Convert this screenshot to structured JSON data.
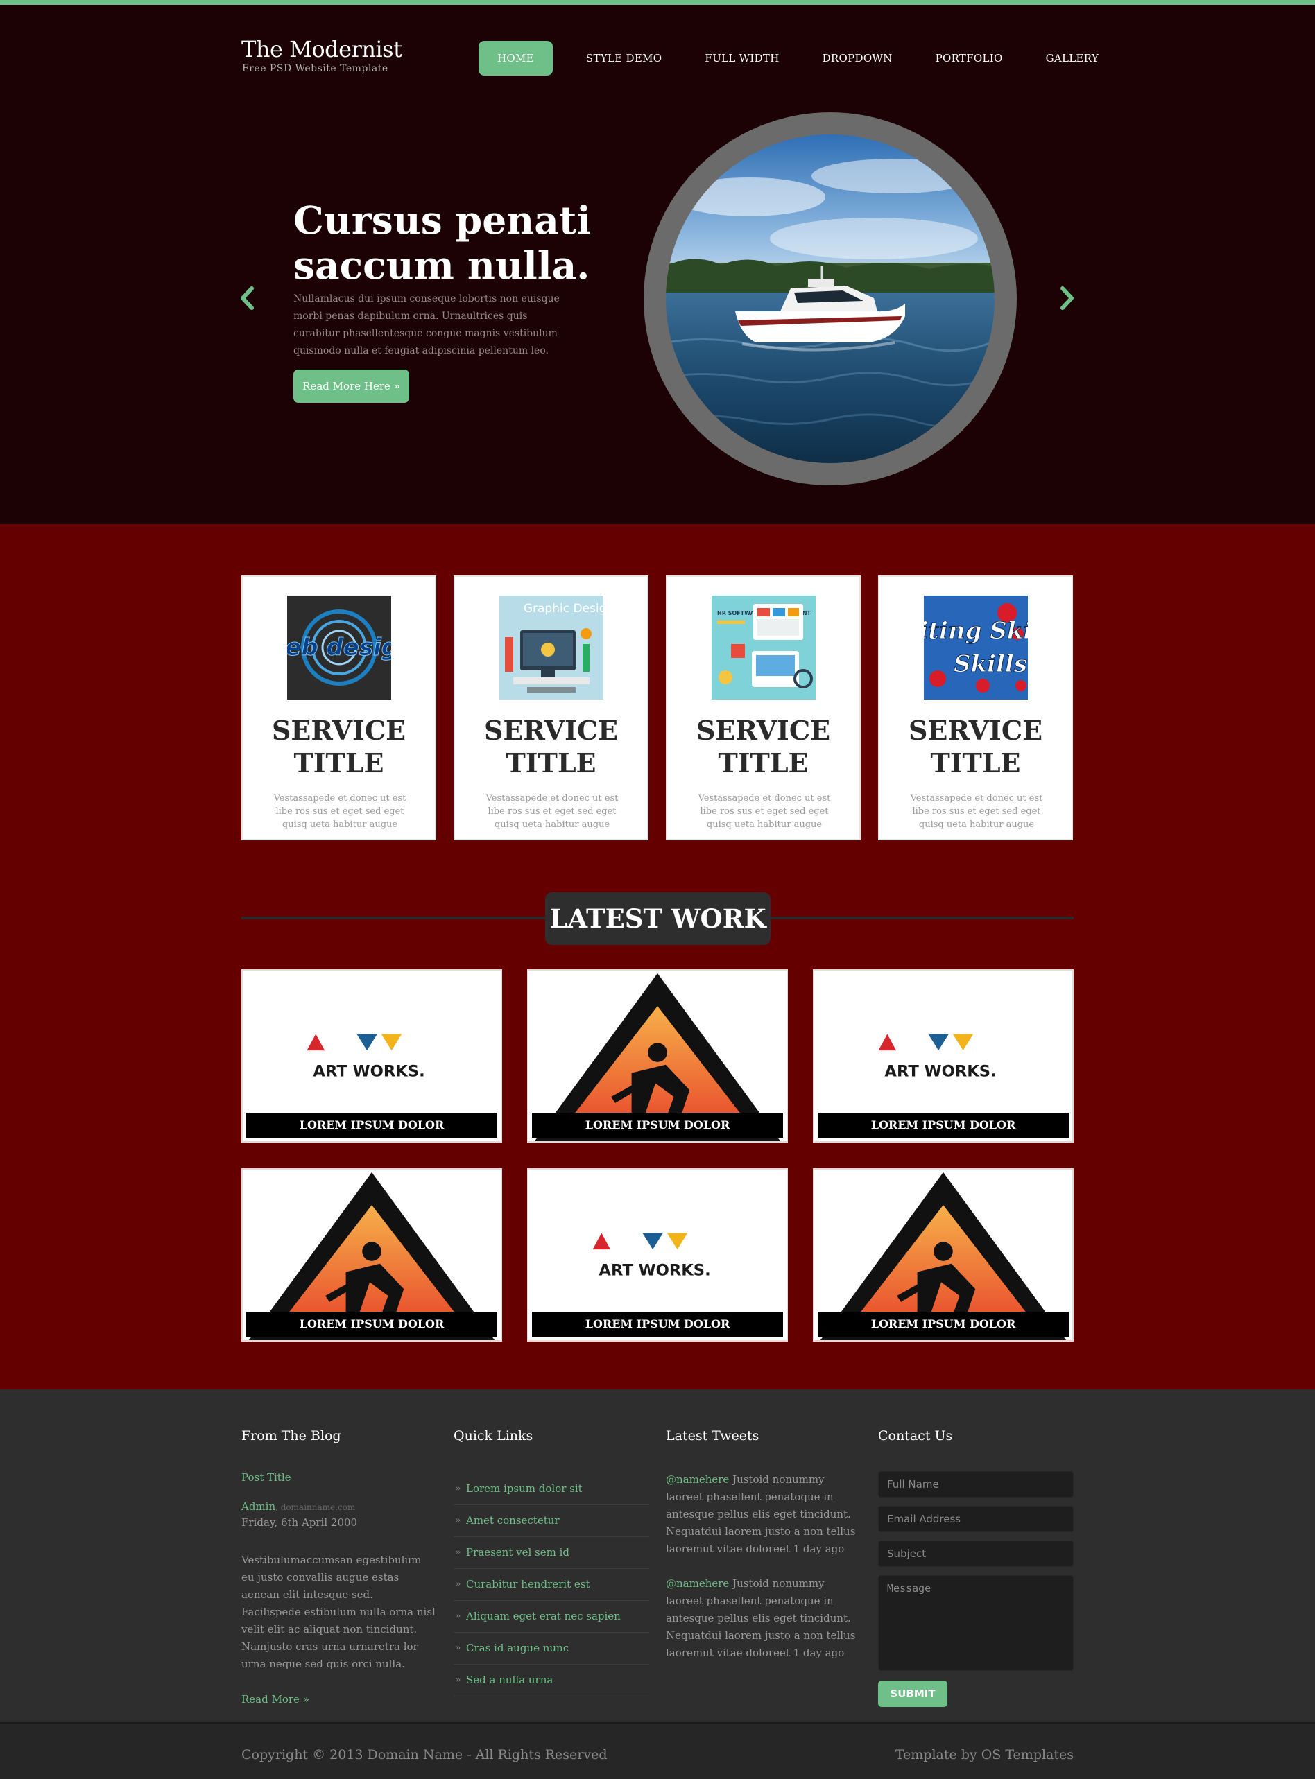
{
  "brand": {
    "title": "The Modernist",
    "subtitle": "Free PSD Website Template"
  },
  "nav": [
    {
      "label": "HOME",
      "active": true
    },
    {
      "label": "STYLE DEMO"
    },
    {
      "label": "FULL WIDTH"
    },
    {
      "label": "DROPDOWN"
    },
    {
      "label": "PORTFOLIO"
    },
    {
      "label": "GALLERY"
    }
  ],
  "hero": {
    "heading": "Cursus penati saccum nulla.",
    "text": "Nullamlacus dui ipsum conseque lobortis non euisque morbi penas dapibulum orna. Urnaultrices quis curabitur phasellentesque congue magnis vestibulum quismodo nulla et feugiat adipiscinia pellentum leo.",
    "button": "Read More Here »"
  },
  "services": [
    {
      "title": "SERVICE TITLE",
      "text": "Vestassapede et donec ut est libe ros sus et eget sed eget quisq ueta habitur augue",
      "image_text": "web design"
    },
    {
      "title": "SERVICE TITLE",
      "text": "Vestassapede et donec ut est libe ros sus et eget sed eget quisq ueta habitur augue",
      "image_text": "Graphic Design"
    },
    {
      "title": "SERVICE TITLE",
      "text": "Vestassapede et donec ut est libe ros sus et eget sed eget quisq ueta habitur augue",
      "image_text": "HR SOFTWARE DEVELOPMENT"
    },
    {
      "title": "SERVICE TITLE",
      "text": "Vestassapede et donec ut est libe ros sus et eget sed eget quisq ueta habitur augue",
      "image_text": "Writing Skills"
    }
  ],
  "latest_work": {
    "title": "LATEST WORK",
    "items": [
      {
        "caption": "LOREM IPSUM DOLOR",
        "art": "artworks",
        "art_text": "ART WORKS."
      },
      {
        "caption": "LOREM IPSUM DOLOR",
        "art": "worker"
      },
      {
        "caption": "LOREM IPSUM DOLOR",
        "art": "artworks",
        "art_text": "ART WORKS."
      },
      {
        "caption": "LOREM IPSUM DOLOR",
        "art": "worker"
      },
      {
        "caption": "LOREM IPSUM DOLOR",
        "art": "artworks",
        "art_text": "ART WORKS."
      },
      {
        "caption": "LOREM IPSUM DOLOR",
        "art": "worker"
      }
    ]
  },
  "footer": {
    "blog": {
      "heading": "From The Blog",
      "post_title": "Post Title",
      "author": "Admin",
      "domain": ", domainname.com",
      "date": "Friday, 6th April 2000",
      "body": "Vestibulumaccumsan egestibulum eu justo convallis augue estas aenean elit intesque sed. Facilispede estibulum nulla orna nisl velit elit ac aliquat non tincidunt. Namjusto cras urna urnaretra lor urna neque sed quis orci nulla.",
      "read_more": "Read More »"
    },
    "quick_links": {
      "heading": "Quick Links",
      "items": [
        "Lorem ipsum dolor sit",
        "Amet consectetur",
        "Praesent vel sem id",
        "Curabitur hendrerit est",
        "Aliquam eget erat nec sapien",
        "Cras id augue nunc",
        "Sed a nulla urna"
      ]
    },
    "tweets": {
      "heading": "Latest Tweets",
      "items": [
        {
          "handle": "@namehere",
          "text": " Justoid nonummy laoreet phasellent penatoque in antesque pellus elis eget tincidunt. Nequatdui laorem justo a non tellus laoremut vitae doloreet 1 day ago"
        },
        {
          "handle": "@namehere",
          "text": " Justoid nonummy laoreet phasellent penatoque in antesque pellus elis eget tincidunt. Nequatdui laorem justo a non tellus laoremut vitae doloreet 1 day ago"
        }
      ]
    },
    "contact": {
      "heading": "Contact Us",
      "full_name": "Full Name",
      "email": "Email Address",
      "subject": "Subject",
      "message": "Message",
      "submit": "SUBMIT"
    }
  },
  "bottom": {
    "copyright": "Copyright © 2013 Domain Name - All Rights Reserved",
    "credit": "Template by OS Templates"
  },
  "colors": {
    "accent": "#6fbf88",
    "hero_bg": "#1c0205",
    "main_bg": "#640000",
    "footer_bg": "#2e2e2e"
  }
}
